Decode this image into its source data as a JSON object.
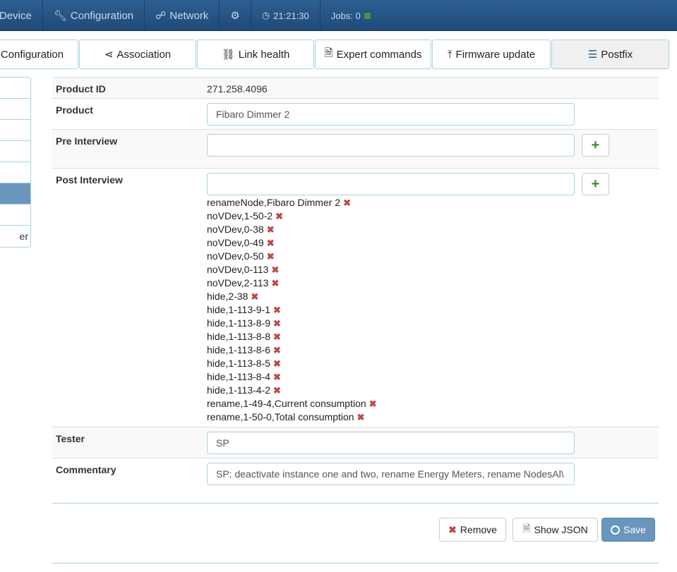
{
  "nav": {
    "items": [
      "Device",
      "Configuration",
      "Network",
      "",
      "21:21:30",
      "Jobs: 0"
    ]
  },
  "tabs": [
    "Configuration",
    "Association",
    "Link health",
    "Expert commands",
    "Firmware update",
    "Postfix"
  ],
  "sidebar": {
    "items": [
      "",
      "",
      "",
      "",
      "",
      "",
      "",
      "er"
    ]
  },
  "form": {
    "product_id_label": "Product ID",
    "product_id": "271.258.4096",
    "product_label": "Product",
    "product": "Fibaro Dimmer 2",
    "pre_label": "Pre Interview",
    "pre_value": "",
    "post_label": "Post Interview",
    "post_value": "",
    "post_items": [
      "renameNode,Fibaro Dimmer 2",
      "noVDev,1-50-2",
      "noVDev,0-38",
      "noVDev,0-49",
      "noVDev,0-50",
      "noVDev,0-113",
      "noVDev,2-113",
      "hide,2-38",
      "hide,1-113-9-1",
      "hide,1-113-8-9",
      "hide,1-113-8-8",
      "hide,1-113-8-6",
      "hide,1-113-8-5",
      "hide,1-113-8-4",
      "hide,1-113-4-2",
      "rename,1-49-4,Current consumption",
      "rename,1-50-0,Total consumption"
    ],
    "tester_label": "Tester",
    "tester": "SP",
    "commentary_label": "Commentary",
    "commentary": "SP: deactivate instance one and two, rename Energy Meters, rename NodesAl\\"
  },
  "buttons": {
    "remove": "Remove",
    "show_json": "Show JSON",
    "save": "Save"
  },
  "colors": {
    "nav": "#1f4a78",
    "active": "#6a96bd",
    "remove_x": "#b94a48",
    "plus": "#3a8a3a",
    "jobs": "#3c9a3c"
  }
}
